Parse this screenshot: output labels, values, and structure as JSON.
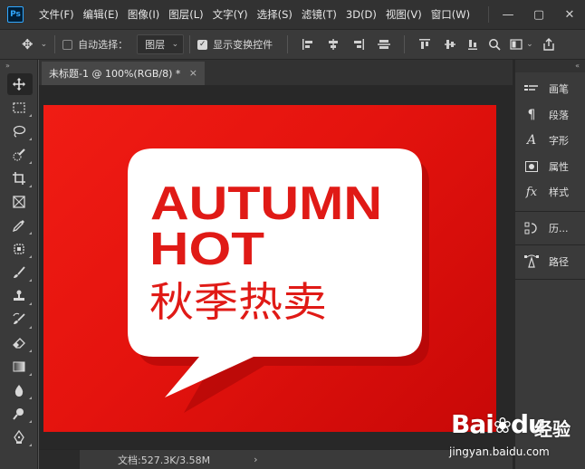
{
  "app": {
    "logo": "Ps",
    "accent": "#31a8ff"
  },
  "menu": {
    "items": [
      "文件(F)",
      "编辑(E)",
      "图像(I)",
      "图层(L)",
      "文字(Y)",
      "选择(S)",
      "滤镜(T)",
      "3D(D)",
      "视图(V)",
      "窗口(W)"
    ]
  },
  "window_controls": {
    "minimize": "—",
    "restore": "▢",
    "close": "✕"
  },
  "options": {
    "auto_select_label": "自动选择：",
    "auto_select_checked": false,
    "layer_select_value": "图层",
    "show_transform_label": "显示变换控件",
    "show_transform_checked": true
  },
  "document": {
    "tab_title": "未标题-1 @ 100%(RGB/8) *",
    "tab_close": "×",
    "status_text": "文档:527.3K/3.58M",
    "status_arrow": "›"
  },
  "artwork": {
    "line1": "AUTUMN",
    "line2": "HOT",
    "line3": "秋季热卖",
    "bg_color": "#e4130e",
    "text_color": "#e01a16",
    "bubble_color": "#ffffff"
  },
  "panels": {
    "group1": [
      {
        "icon": "brush-panel-icon",
        "label": "画笔"
      },
      {
        "icon": "paragraph-icon",
        "label": "段落"
      },
      {
        "icon": "character-icon",
        "label": "字形"
      },
      {
        "icon": "properties-icon",
        "label": "属性"
      },
      {
        "icon": "styles-icon",
        "label": "样式"
      }
    ],
    "group2": [
      {
        "icon": "history-icon",
        "label": "历..."
      }
    ],
    "group3": [
      {
        "icon": "paths-icon",
        "label": "路径"
      }
    ]
  },
  "watermark": {
    "logo": "Bai",
    "logo_tail": "du",
    "cn": "经验",
    "url": "jingyan.baidu.com"
  }
}
